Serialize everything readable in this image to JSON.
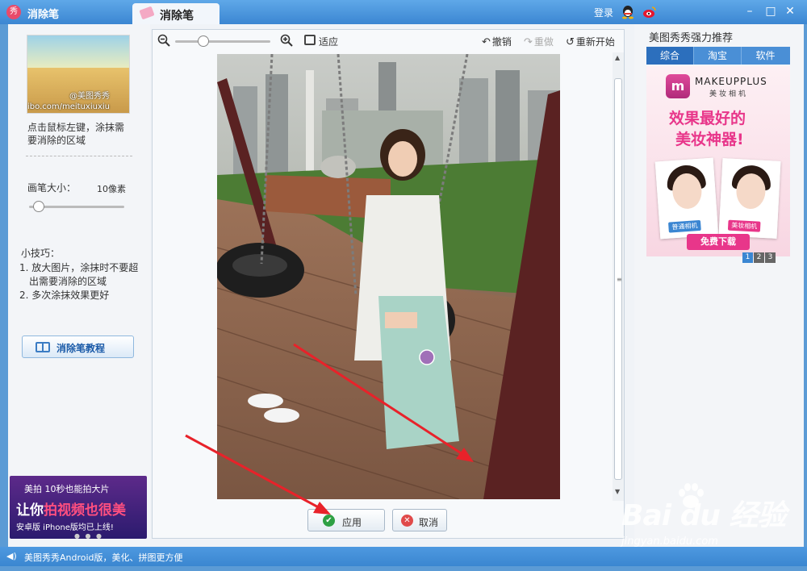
{
  "titlebar": {
    "app_name": "消除笔",
    "app_logo_glyph": "秀",
    "tab_label": "消除笔",
    "login": "登录",
    "window_controls": {
      "minimize": "–",
      "maximize": "□",
      "close": "✕"
    }
  },
  "left_panel": {
    "thumbnail": {
      "watermark": "@美图秀秀",
      "url_text": "ibo.com/meituxiuxiu"
    },
    "hint": "点击鼠标左键，涂抹需要消除的区域",
    "brush_size_label": "画笔大小：",
    "brush_size_value": "10像素",
    "brush_size_fraction": 0.1,
    "tips_title": "小技巧：",
    "tips": [
      "1. 放大图片，涂抹时不要超出需要消除的区域",
      "2. 多次涂抹效果更好"
    ],
    "tutorial_button": "消除笔教程",
    "promo": {
      "line1": "美拍 10秒也能拍大片",
      "line2_prefix": "让你",
      "line2_highlight": "拍视频也很美",
      "line3": "安卓版  iPhone版均已上线!",
      "dots": "● ● ●"
    }
  },
  "editor": {
    "zoom_fraction": 0.3,
    "fit_label": "适应",
    "undo_label": "撤销",
    "redo_label": "重做",
    "restart_label": "重新开始",
    "apply_button": "应用",
    "cancel_button": "取消",
    "scroll": {
      "up": "▲",
      "down": "▼",
      "grip": "≡"
    }
  },
  "right_panel": {
    "title": "美图秀秀强力推荐",
    "tabs": [
      "综合",
      "淘宝",
      "软件"
    ],
    "active_tab": 0,
    "ad": {
      "logo_glyph": "m",
      "brand": "MAKEUPPLUS",
      "brand_sub": "美妆相机",
      "headline1": "效果最好的",
      "headline2": "美妆神器!",
      "tag_before": "普通相机",
      "tag_after": "美妆相机",
      "download": "免费下载"
    },
    "pages": [
      "1",
      "2",
      "3"
    ],
    "active_page": 0
  },
  "statusbar": {
    "text": "美图秀秀Android版，美化、拼图更方便"
  },
  "watermark": {
    "main": "Bai du 经验",
    "sub": "jingyan.baidu.com"
  },
  "colors": {
    "titlebar": "#3b86d2",
    "accent": "#4a8fd6",
    "ad_pink": "#e8368a"
  }
}
